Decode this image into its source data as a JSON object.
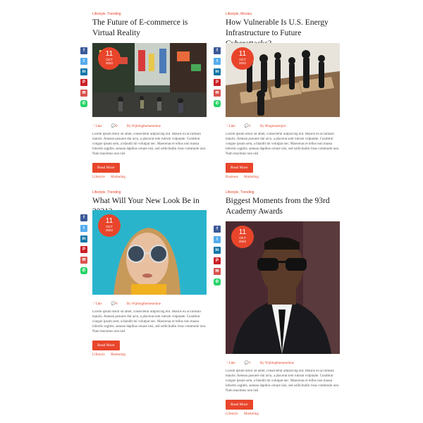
{
  "posts": [
    {
      "categories": "Lifestyle, Trending",
      "title": "The Future of E-commerce is Virtual Reality",
      "date": {
        "day": "11",
        "month": "OCT",
        "year": "2022"
      },
      "likes": "Like",
      "comments": "0",
      "author": "By Wpblogthemeselone",
      "excerpt": "Lorem ipsum dolor sit amet, consectetur adipiscing elit. Mauris eu accumsan mauris. Aenean posuere dui arcu, a placerat sem rutrum vulputate. Curabitur congue ipsum sem, a blandit mi volutpat nec. Maecenas et tellus non massa lobortis sagittis. aenean dapibus ornare nisi, sed sollicitudin risus commodo non. Nam maximus non nisl",
      "read_more": "Read More",
      "tags": [
        "Lifestyle",
        "Marketing"
      ]
    },
    {
      "categories": "Lifestyle, Movies",
      "title": "How Vulnerable Is U.S. Energy Infrastructure to Future Cyberattacks?",
      "date": {
        "day": "11",
        "month": "OCT",
        "year": "2022"
      },
      "likes": "Like",
      "comments": "1",
      "author": "By Blogmasterpro",
      "excerpt": "Lorem ipsum dolor sit amet, consectetur adipiscing elit. Mauris eu accumsan mauris. Aenean posuere dui arcu, a placerat sem rutrum vulputate. Curabitur congue ipsum sem, a blandit mi volutpat nec. Maecenas et tellus non massa lobortis sagittis. aenean dapibus ornare nisi, sed sollicitudin risus commodo non. Nam maximus non nisl",
      "read_more": "Read More",
      "tags": [
        "Business",
        "Marketing"
      ]
    },
    {
      "categories": "Lifestyle, Trending",
      "title": "What Will Your New Look Be in 2021?",
      "date": {
        "day": "11",
        "month": "OCT",
        "year": "2022"
      },
      "likes": "Like",
      "comments": "0",
      "author": "By Wpblogthemeselone",
      "excerpt": "Lorem ipsum dolor sit amet, consectetur adipiscing elit. Mauris eu accumsan mauris. Aenean posuere dui arcu, a placerat sem rutrum vulputate. Curabitur congue ipsum sem, a blandit mi volutpat nec. Maecenas et tellus non massa lobortis sagittis. aenean dapibus ornare nisi, sed sollicitudin risus commodo non. Nam maximus non nisl",
      "read_more": "Read More",
      "tags": [
        "Lifestyle",
        "Marketing"
      ]
    },
    {
      "categories": "Lifestyle, Trending",
      "title": "Biggest Moments from the 93rd Academy Awards",
      "date": {
        "day": "11",
        "month": "OCT",
        "year": "2022"
      },
      "likes": "Like",
      "comments": "1",
      "author": "By Wpblogthemeselone",
      "excerpt": "Lorem ipsum dolor sit amet, consectetur adipiscing elit. Mauris eu accumsan mauris. Aenean posuere dui arcu, a placerat sem rutrum vulputate. Curabitur congue ipsum sem, a blandit mi volutpat nec. Maecenas et tellus non massa lobortis sagittis. aenean dapibus ornare nisi, sed sollicitudin risus commodo non. Nam maximus non nisl",
      "read_more": "Read More",
      "tags": [
        "Lifestyle",
        "Marketing"
      ]
    }
  ],
  "share_icons": [
    "facebook-icon",
    "twitter-icon",
    "linkedin-icon",
    "pinterest-icon",
    "mail-icon",
    "whatsapp-icon"
  ],
  "colors": {
    "accent": "#e8452b",
    "facebook": "#3b5998",
    "twitter": "#55acee",
    "linkedin": "#0e76a8",
    "pinterest": "#cb2027",
    "whatsapp": "#25d366"
  }
}
